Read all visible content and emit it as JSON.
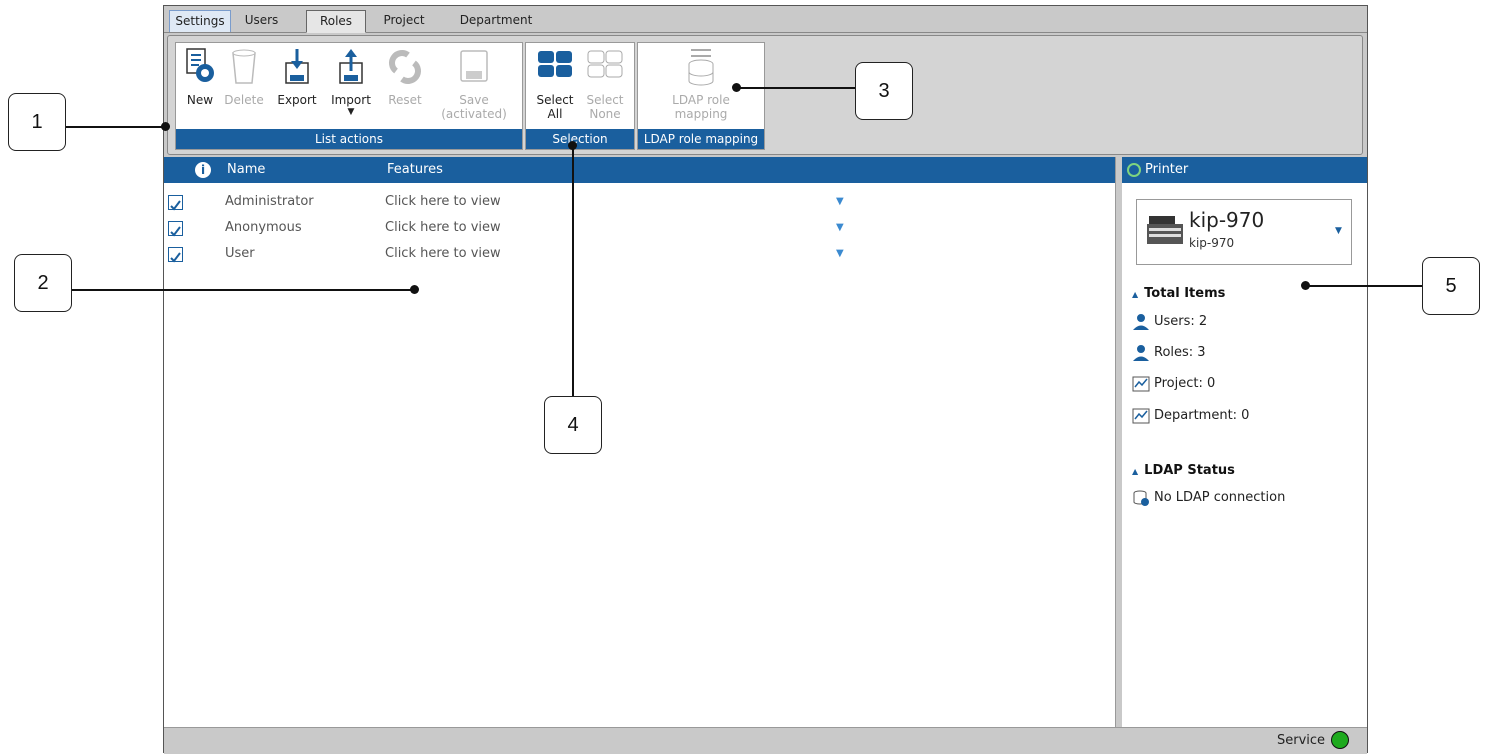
{
  "tabs": [
    "Settings",
    "Users",
    "Roles",
    "Project",
    "Department"
  ],
  "ribbon": {
    "list_actions": {
      "label": "List actions",
      "new": "New",
      "delete": "Delete",
      "export": "Export",
      "import": "Import",
      "reset": "Reset",
      "save_line1": "Save",
      "save_line2": "(activated)"
    },
    "selection": {
      "label": "Selection",
      "select_all_1": "Select",
      "select_all_2": "All",
      "select_none_1": "Select",
      "select_none_2": "None"
    },
    "ldap": {
      "label": "LDAP role mapping",
      "btn_line1": "LDAP role",
      "btn_line2": "mapping"
    }
  },
  "grid": {
    "col_name": "Name",
    "col_features": "Features",
    "rows": [
      {
        "name": "Administrator",
        "features": "Click here to view"
      },
      {
        "name": "Anonymous",
        "features": "Click here to view"
      },
      {
        "name": "User",
        "features": "Click here to view"
      }
    ]
  },
  "side": {
    "title": "Printer",
    "printer_name": "kip-970",
    "printer_sub": "kip-970",
    "total_items_label": "Total Items",
    "users": "Users: 2",
    "roles": "Roles: 3",
    "project": "Project: 0",
    "department": "Department: 0",
    "ldap_status_label": "LDAP Status",
    "ldap_status": "No LDAP connection"
  },
  "status": {
    "service": "Service",
    "service_color": "#1eaa1e"
  },
  "callouts": [
    "1",
    "2",
    "3",
    "4",
    "5"
  ],
  "colors": {
    "accent": "#1a5f9e"
  }
}
